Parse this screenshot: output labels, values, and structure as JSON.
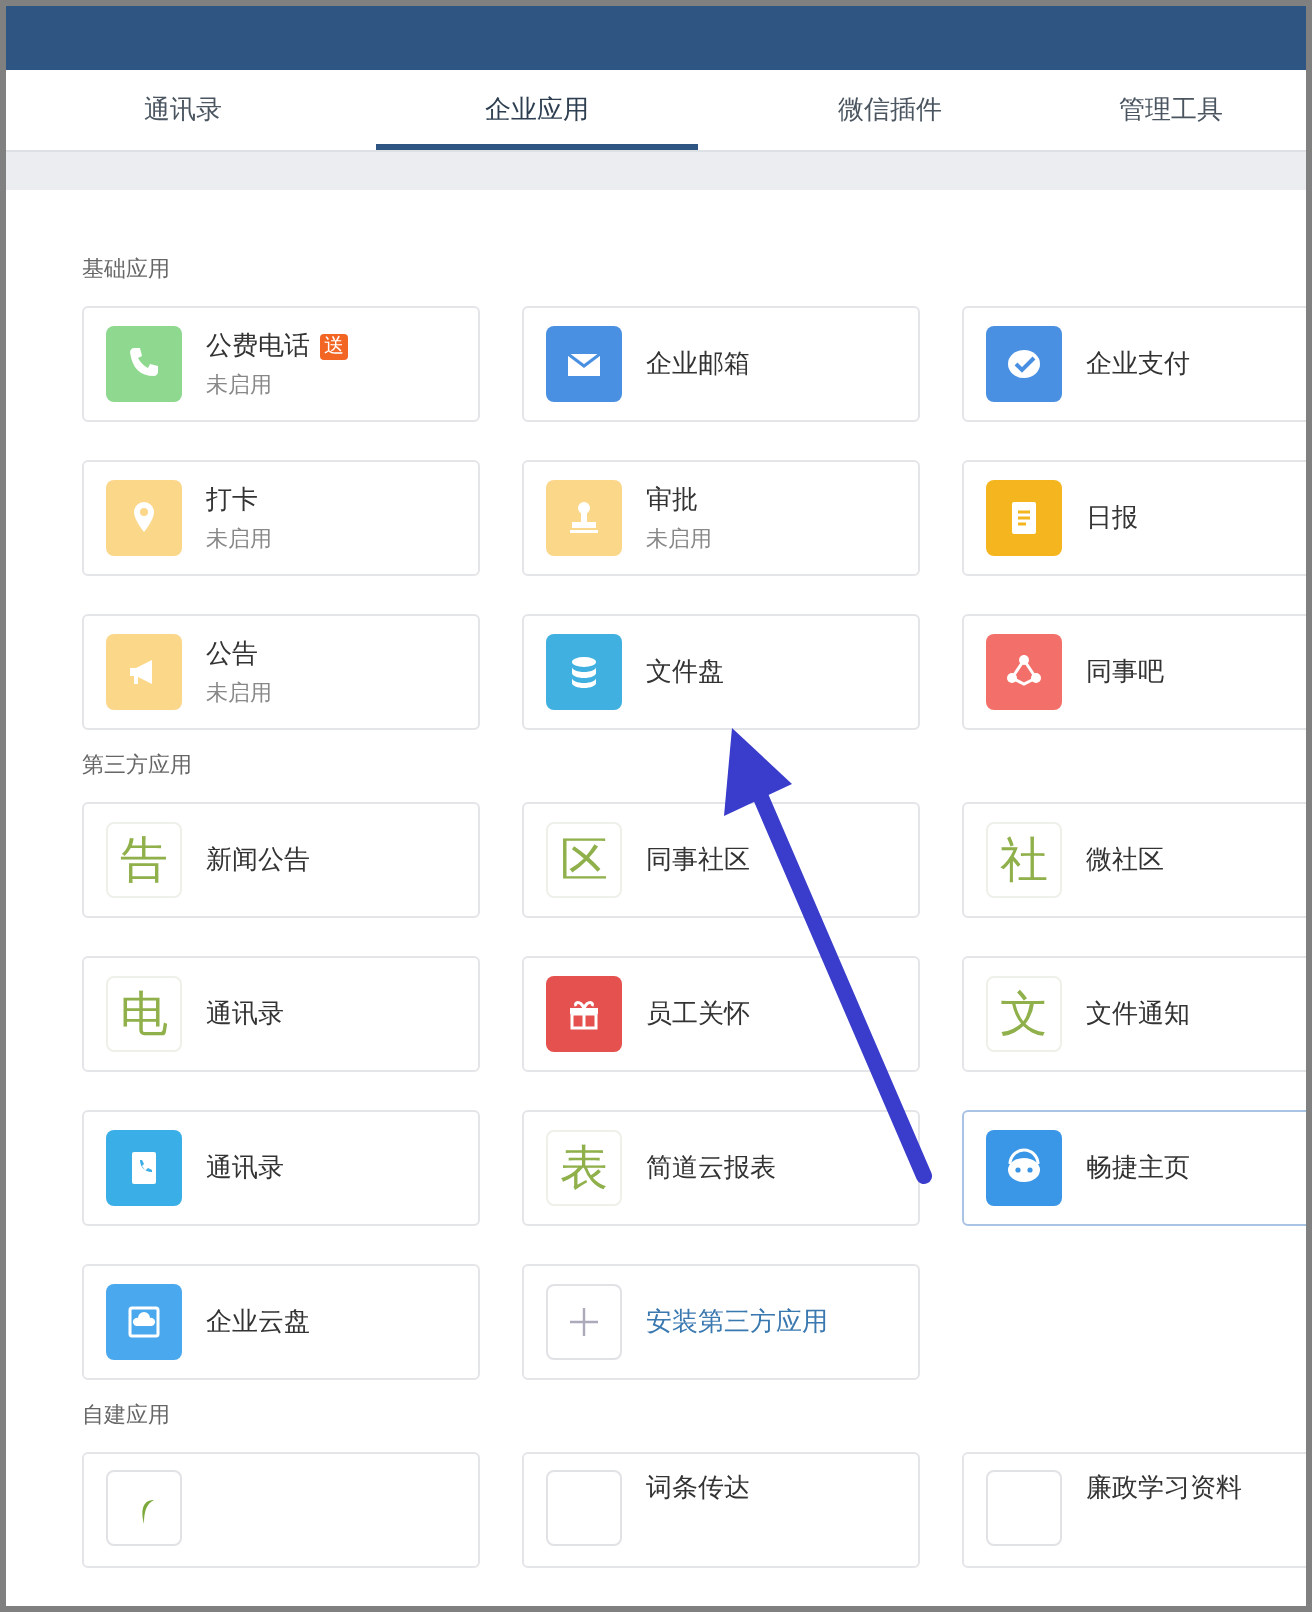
{
  "tabs": [
    {
      "label": "通讯录",
      "selected": false
    },
    {
      "label": "企业应用",
      "selected": true
    },
    {
      "label": "微信插件",
      "selected": false
    },
    {
      "label": "管理工具",
      "selected": false
    }
  ],
  "sections": [
    {
      "title": "基础应用",
      "apps": [
        {
          "name": "公费电话",
          "status": "未启用",
          "badge": "送",
          "kind": "phone",
          "color": "#8fd88f"
        },
        {
          "name": "企业邮箱",
          "kind": "mail",
          "color": "#4a90e2"
        },
        {
          "name": "企业支付",
          "kind": "pay",
          "color": "#4a90e2"
        },
        {
          "name": "打卡",
          "status": "未启用",
          "kind": "pin",
          "color": "#fbd78a"
        },
        {
          "name": "审批",
          "status": "未启用",
          "kind": "stamp",
          "color": "#fbd78a"
        },
        {
          "name": "日报",
          "kind": "report",
          "color": "#f5b51e"
        },
        {
          "name": "公告",
          "status": "未启用",
          "kind": "horn",
          "color": "#fbd78a"
        },
        {
          "name": "文件盘",
          "kind": "disk",
          "color": "#3fb0e0"
        },
        {
          "name": "同事吧",
          "kind": "share",
          "color": "#f36f6a"
        }
      ]
    },
    {
      "title": "第三方应用",
      "apps": [
        {
          "name": "新闻公告",
          "kind": "glyph",
          "glyph": "告"
        },
        {
          "name": "同事社区",
          "kind": "glyph",
          "glyph": "区"
        },
        {
          "name": "微社区",
          "kind": "glyph",
          "glyph": "社"
        },
        {
          "name": "通讯录",
          "kind": "glyph",
          "glyph": "电"
        },
        {
          "name": "员工关怀",
          "kind": "gift",
          "color": "#e5514f"
        },
        {
          "name": "文件通知",
          "kind": "glyph",
          "glyph": "文"
        },
        {
          "name": "通讯录",
          "kind": "book",
          "color": "#3aaee6"
        },
        {
          "name": "简道云报表",
          "kind": "glyph",
          "glyph": "表"
        },
        {
          "name": "畅捷主页",
          "kind": "robot",
          "color": "#3a96e6",
          "selected": true
        },
        {
          "name": "企业云盘",
          "kind": "cloud",
          "color": "#4aa8ee"
        },
        {
          "name": "安装第三方应用",
          "kind": "plus"
        }
      ]
    },
    {
      "title": "自建应用",
      "apps": [
        {
          "kind": "leaf"
        },
        {
          "name": "词条传达",
          "kind": "blank"
        },
        {
          "name": "廉政学习资料",
          "kind": "blank"
        }
      ]
    }
  ]
}
